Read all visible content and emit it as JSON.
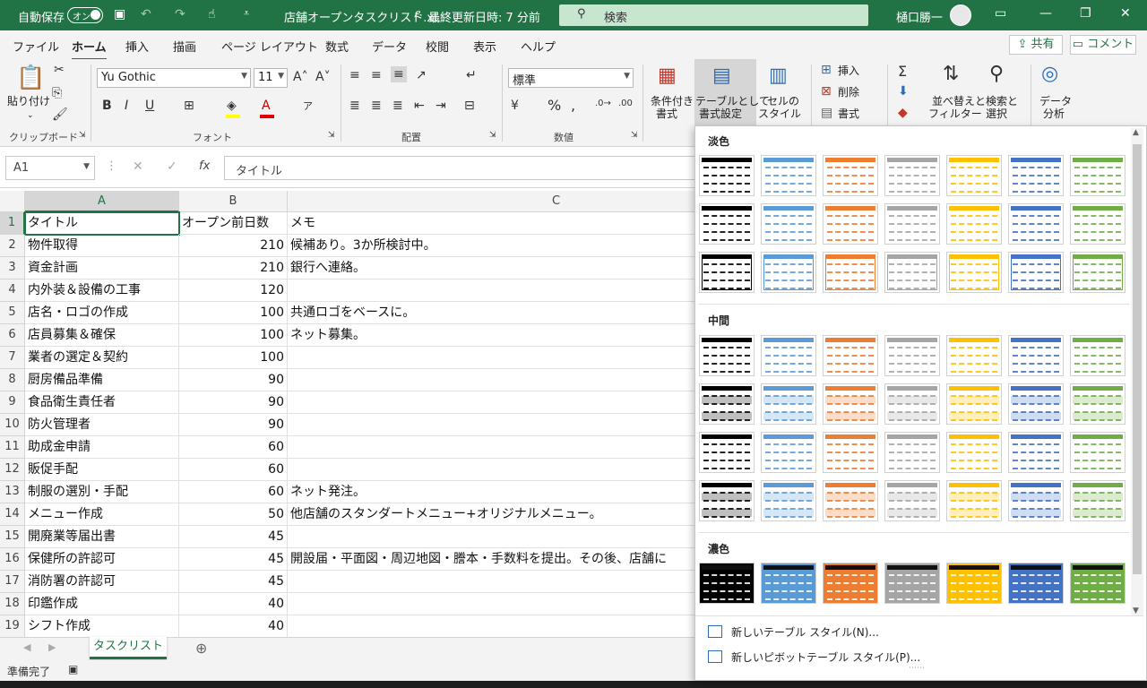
{
  "titlebar": {
    "autosave_label": "自動保存",
    "autosave_state": "オン",
    "title": "店舗オープンタスクリスト.xl…",
    "saved_status": "最終更新日時: 7 分前",
    "search_placeholder": "検索",
    "user_name": "樋口勝一"
  },
  "tabs": [
    "ファイル",
    "ホーム",
    "挿入",
    "描画",
    "ページ レイアウト",
    "数式",
    "データ",
    "校閲",
    "表示",
    "ヘルプ"
  ],
  "share_label": "共有",
  "comment_label": "コメント",
  "ribbon": {
    "paste_label": "貼り付け",
    "clipboard_group": "クリップボード",
    "font_name": "Yu Gothic",
    "font_size": "11",
    "font_group": "フォント",
    "alignment_group": "配置",
    "number_format": "標準",
    "number_group": "数値",
    "conditional_format_l1": "条件付き",
    "conditional_format_l2": "書式",
    "format_as_table_l1": "テーブルとして",
    "format_as_table_l2": "書式設定",
    "cell_styles_l1": "セルの",
    "cell_styles_l2": "スタイル",
    "insert_label": "挿入",
    "delete_label": "削除",
    "format_label": "書式",
    "sort_filter_l1": "並べ替えと",
    "sort_filter_l2": "フィルター",
    "find_select_l1": "検索と",
    "find_select_l2": "選択",
    "data_analysis_l1": "データ",
    "data_analysis_l2": "分析"
  },
  "formula_bar": {
    "name_box": "A1",
    "fx": "fx",
    "content": "タイトル"
  },
  "columns": [
    "A",
    "B",
    "C"
  ],
  "rows": [
    {
      "num": "1",
      "a": "タイトル",
      "b": "オープン前日数",
      "c": "メモ"
    },
    {
      "num": "2",
      "a": "物件取得",
      "b": "210",
      "c": "候補あり。3か所検討中。"
    },
    {
      "num": "3",
      "a": "資金計画",
      "b": "210",
      "c": "銀行へ連絡。"
    },
    {
      "num": "4",
      "a": "内外装＆設備の工事",
      "b": "120",
      "c": ""
    },
    {
      "num": "5",
      "a": "店名・ロゴの作成",
      "b": "100",
      "c": "共通ロゴをベースに。"
    },
    {
      "num": "6",
      "a": "店員募集＆確保",
      "b": "100",
      "c": "ネット募集。"
    },
    {
      "num": "7",
      "a": "業者の選定＆契約",
      "b": "100",
      "c": ""
    },
    {
      "num": "8",
      "a": "厨房備品準備",
      "b": "90",
      "c": ""
    },
    {
      "num": "9",
      "a": "食品衛生責任者",
      "b": "90",
      "c": ""
    },
    {
      "num": "10",
      "a": "防火管理者",
      "b": "90",
      "c": ""
    },
    {
      "num": "11",
      "a": "助成金申請",
      "b": "60",
      "c": ""
    },
    {
      "num": "12",
      "a": "販促手配",
      "b": "60",
      "c": ""
    },
    {
      "num": "13",
      "a": "制服の選別・手配",
      "b": "60",
      "c": "ネット発注。"
    },
    {
      "num": "14",
      "a": "メニュー作成",
      "b": "50",
      "c": "他店舗のスタンダートメニュー+オリジナルメニュー。"
    },
    {
      "num": "15",
      "a": "開廃業等届出書",
      "b": "45",
      "c": ""
    },
    {
      "num": "16",
      "a": "保健所の許認可",
      "b": "45",
      "c": "開設届・平面図・周辺地図・謄本・手数料を提出。その後、店舗に"
    },
    {
      "num": "17",
      "a": "消防署の許認可",
      "b": "45",
      "c": ""
    },
    {
      "num": "18",
      "a": "印鑑作成",
      "b": "40",
      "c": ""
    },
    {
      "num": "19",
      "a": "シフト作成",
      "b": "40",
      "c": ""
    }
  ],
  "sheet_tab": "タスクリスト",
  "status": "準備完了",
  "gallery": {
    "section_light": "淡色",
    "section_medium": "中間",
    "section_dark": "濃色",
    "new_table_style": "新しいテーブル スタイル(N)...",
    "new_pivot_style": "新しいピボットテーブル スタイル(P)...",
    "colors": [
      "#000000",
      "#4472c4",
      "#ed7d31",
      "#a5a5a5",
      "#ffc000",
      "#5b9bd5",
      "#70ad47"
    ],
    "colors_alt": [
      "#000000",
      "#5b9bd5",
      "#ed7d31",
      "#a5a5a5",
      "#ffc000",
      "#4472c4",
      "#70ad47"
    ]
  }
}
